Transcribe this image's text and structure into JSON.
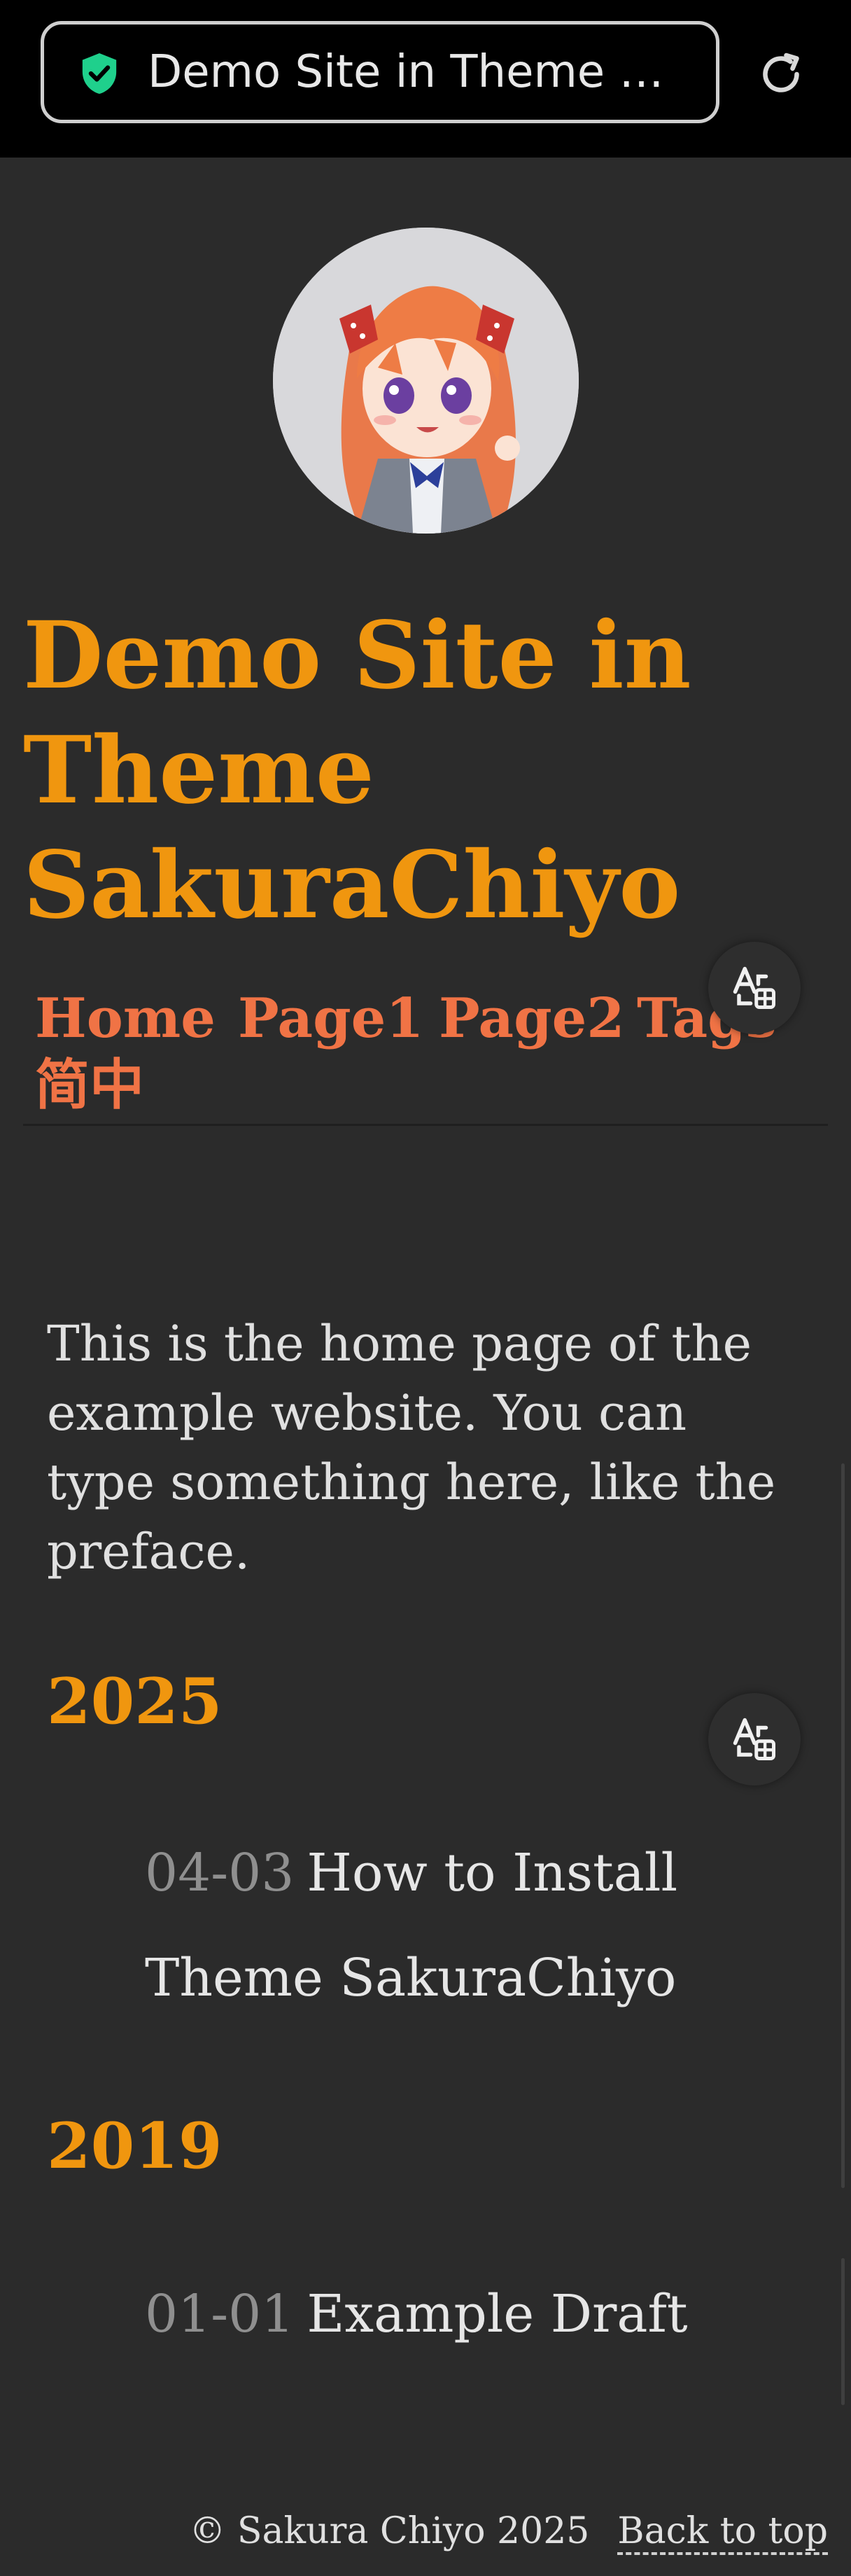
{
  "browser": {
    "url_text": "Demo Site in Theme SakuraChiyo",
    "accent": "#1fd08c"
  },
  "site": {
    "title": "Demo Site in Theme SakuraChiyo",
    "title_color": "#f0960f",
    "avatar_alt": "avatar"
  },
  "nav": {
    "items": [
      {
        "label": "Home"
      },
      {
        "label": "Page1"
      },
      {
        "label": "Page2"
      },
      {
        "label": "Tags"
      },
      {
        "label": "简中"
      }
    ],
    "color": "#f07345"
  },
  "main": {
    "intro": "This is the home page of the example website. You can type something here, like the preface.",
    "groups": [
      {
        "year": "2025",
        "posts": [
          {
            "date": "04-03",
            "title": "How to Install Theme SakuraChiyo"
          }
        ]
      },
      {
        "year": "2019",
        "posts": [
          {
            "date": "01-01",
            "title": "Example Draft"
          }
        ]
      }
    ]
  },
  "footer": {
    "copyright": "© Sakura Chiyo 2025",
    "back_to_top": "Back to top"
  },
  "icons": {
    "shield": "shield-check-icon",
    "reload": "reload-icon",
    "translate": "translate-icon"
  }
}
